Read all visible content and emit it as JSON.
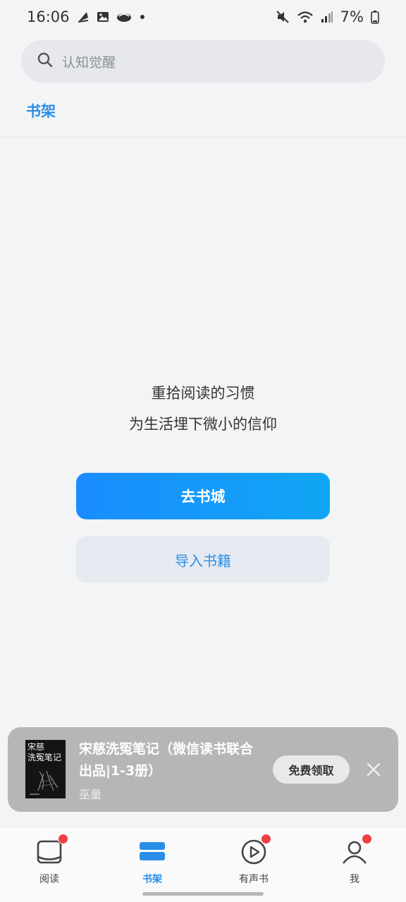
{
  "status_bar": {
    "time": "16:06",
    "battery": "7%",
    "left_icons": [
      "leaf-icon",
      "image-icon",
      "bird-icon",
      "dot-icon"
    ],
    "right_icons": [
      "mute-icon",
      "wifi-icon",
      "signal-icon",
      "battery-icon"
    ]
  },
  "search": {
    "placeholder": "认知觉醒"
  },
  "tabs": {
    "bookshelf": "书架"
  },
  "empty_state": {
    "line1": "重拾阅读的习惯",
    "line2": "为生活埋下微小的信仰"
  },
  "buttons": {
    "go_store": "去书城",
    "import_books": "导入书籍"
  },
  "promo": {
    "title": "宋慈洗冤笔记（微信读书联合出品|1-3册）",
    "author": "巫童",
    "cta": "免费领取",
    "cover_text": "宋慈\n洗冤笔记"
  },
  "bottom_nav": [
    {
      "label": "阅读",
      "icon": "reading-icon",
      "active": false,
      "badge": true
    },
    {
      "label": "书架",
      "icon": "bookshelf-icon",
      "active": true,
      "badge": false
    },
    {
      "label": "有声书",
      "icon": "audiobook-icon",
      "active": false,
      "badge": true
    },
    {
      "label": "我",
      "icon": "profile-icon",
      "active": false,
      "badge": true
    }
  ],
  "colors": {
    "accent": "#2a8ee8",
    "badge": "#f04040"
  }
}
